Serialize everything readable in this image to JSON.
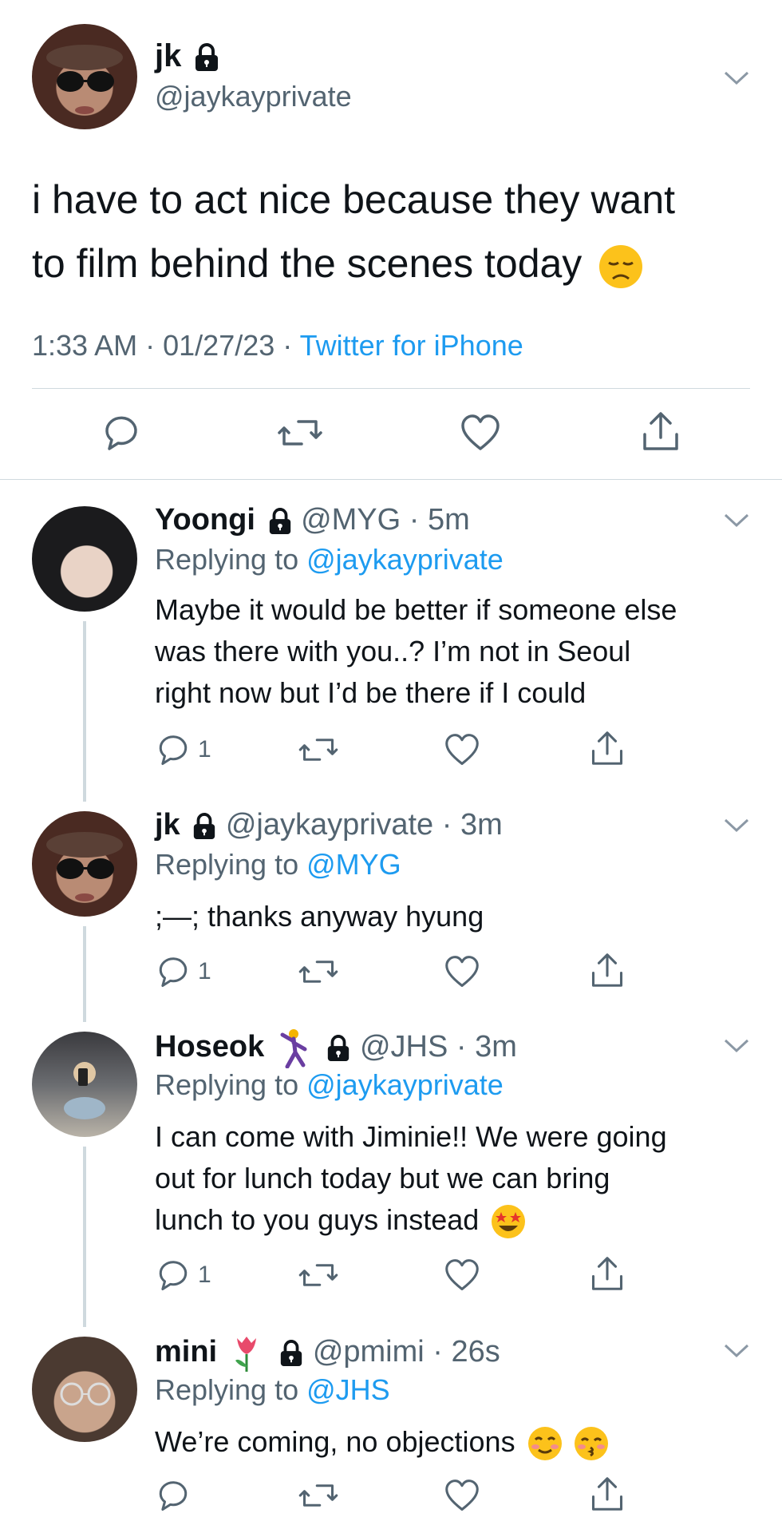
{
  "main_tweet": {
    "name": "jk",
    "handle": "@jaykayprivate",
    "text_line1": "i have to act nice because they want",
    "text_line2": "to film behind the scenes today",
    "time": "1:33 AM",
    "date": "01/27/23",
    "client": "Twitter for iPhone"
  },
  "replies": [
    {
      "name": "Yoongi",
      "handle": "@MYG",
      "time": "5m",
      "replying_prefix": "Replying to",
      "replying_to": "@jaykayprivate",
      "lines": [
        "Maybe it would be better if someone else",
        "was there with you..? I’m not in Seoul",
        "right now but I’d be there if I could"
      ],
      "reply_count": "1"
    },
    {
      "name": "jk",
      "handle": "@jaykayprivate",
      "time": "3m",
      "replying_prefix": "Replying to",
      "replying_to": "@MYG",
      "lines": [
        ";—; thanks anyway hyung"
      ],
      "reply_count": "1"
    },
    {
      "name": "Hoseok",
      "handle": "@JHS",
      "time": "3m",
      "replying_prefix": "Replying to",
      "replying_to": "@jaykayprivate",
      "lines": [
        "I can come with Jiminie!! We were going",
        "out for lunch today but we can bring",
        "lunch to you guys instead"
      ],
      "reply_count": "1"
    },
    {
      "name": "mini",
      "handle": "@pmimi",
      "time": "26s",
      "replying_prefix": "Replying to",
      "replying_to": "@JHS",
      "lines": [
        "We’re coming, no objections"
      ],
      "reply_count": ""
    }
  ],
  "separator": "·",
  "icons": [
    "lock-icon",
    "chevron-down-icon",
    "reply-icon",
    "retweet-icon",
    "like-icon",
    "share-icon",
    "disappointed-emoji",
    "star-struck-emoji",
    "smiling-emoji",
    "kissing-emoji",
    "dancer-emoji",
    "tulip-emoji"
  ],
  "colors": {
    "link": "#1d9bf0",
    "muted": "#536471",
    "text": "#0f1419",
    "divider": "#cfd9de"
  }
}
